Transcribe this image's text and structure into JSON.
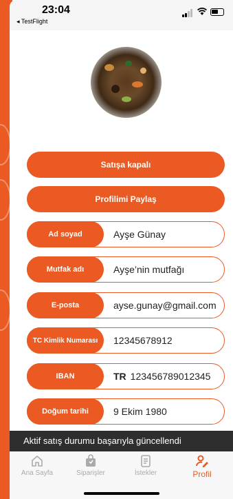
{
  "status_bar": {
    "time": "23:04",
    "back_app": "◂ TestFlight"
  },
  "profile": {
    "avatar_icon": "food-photo",
    "sale_button": "Satışa kapalı",
    "share_button": "Profilimi Paylaş",
    "fields": [
      {
        "label": "Ad soyad",
        "value": "Ayşe Günay"
      },
      {
        "label": "Mutfak adı",
        "value": "Ayşe’nin mutfağı"
      },
      {
        "label": "E-posta",
        "value": "ayse.gunay@gmail.com"
      },
      {
        "label": "TC Kimlik Numarası",
        "value": "12345678912"
      },
      {
        "label": "IBAN",
        "prefix": "TR",
        "value": "123456789012345"
      },
      {
        "label": "Doğum tarihi",
        "value": "9 Ekim 1980"
      }
    ]
  },
  "toast": "Aktif satış durumu başarıyla güncellendi",
  "tabbar": {
    "tabs": [
      {
        "label": "Ana Sayfa",
        "icon": "home-icon",
        "active": false
      },
      {
        "label": "Siparişler",
        "icon": "bag-icon",
        "active": false
      },
      {
        "label": "İstekler",
        "icon": "list-icon",
        "active": false
      },
      {
        "label": "Profil",
        "icon": "profile-edit-icon",
        "active": true
      }
    ]
  },
  "colors": {
    "accent": "#ea5a22",
    "toast_bg": "#2e2e2e",
    "inactive": "#aaaaaa"
  }
}
